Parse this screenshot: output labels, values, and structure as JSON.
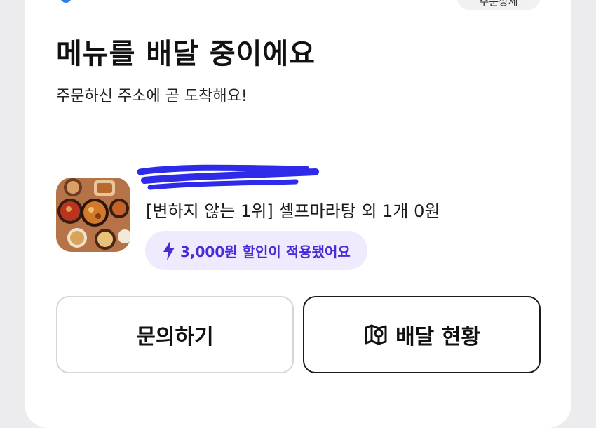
{
  "header": {
    "top_left_cut_text": "",
    "top_right_pill": "주문상세"
  },
  "delivery": {
    "title": "메뉴를 배달 중이에요",
    "subtitle": "주문하신 주소에 곧 도착해요!"
  },
  "order": {
    "store_name_redacted": true,
    "summary": "[변하지 않는 1위] 셀프마라탕 외 1개 0원",
    "discount_text": "3,000원 할인이 적용됐어요"
  },
  "actions": {
    "inquiry_label": "문의하기",
    "status_label": "배달 현황"
  },
  "colors": {
    "accent": "#4a2bd8",
    "badge_bg": "#efeafd",
    "scribble": "#2d2be8"
  },
  "icons": {
    "discount": "lightning-bolt-icon",
    "status": "map-icon"
  }
}
